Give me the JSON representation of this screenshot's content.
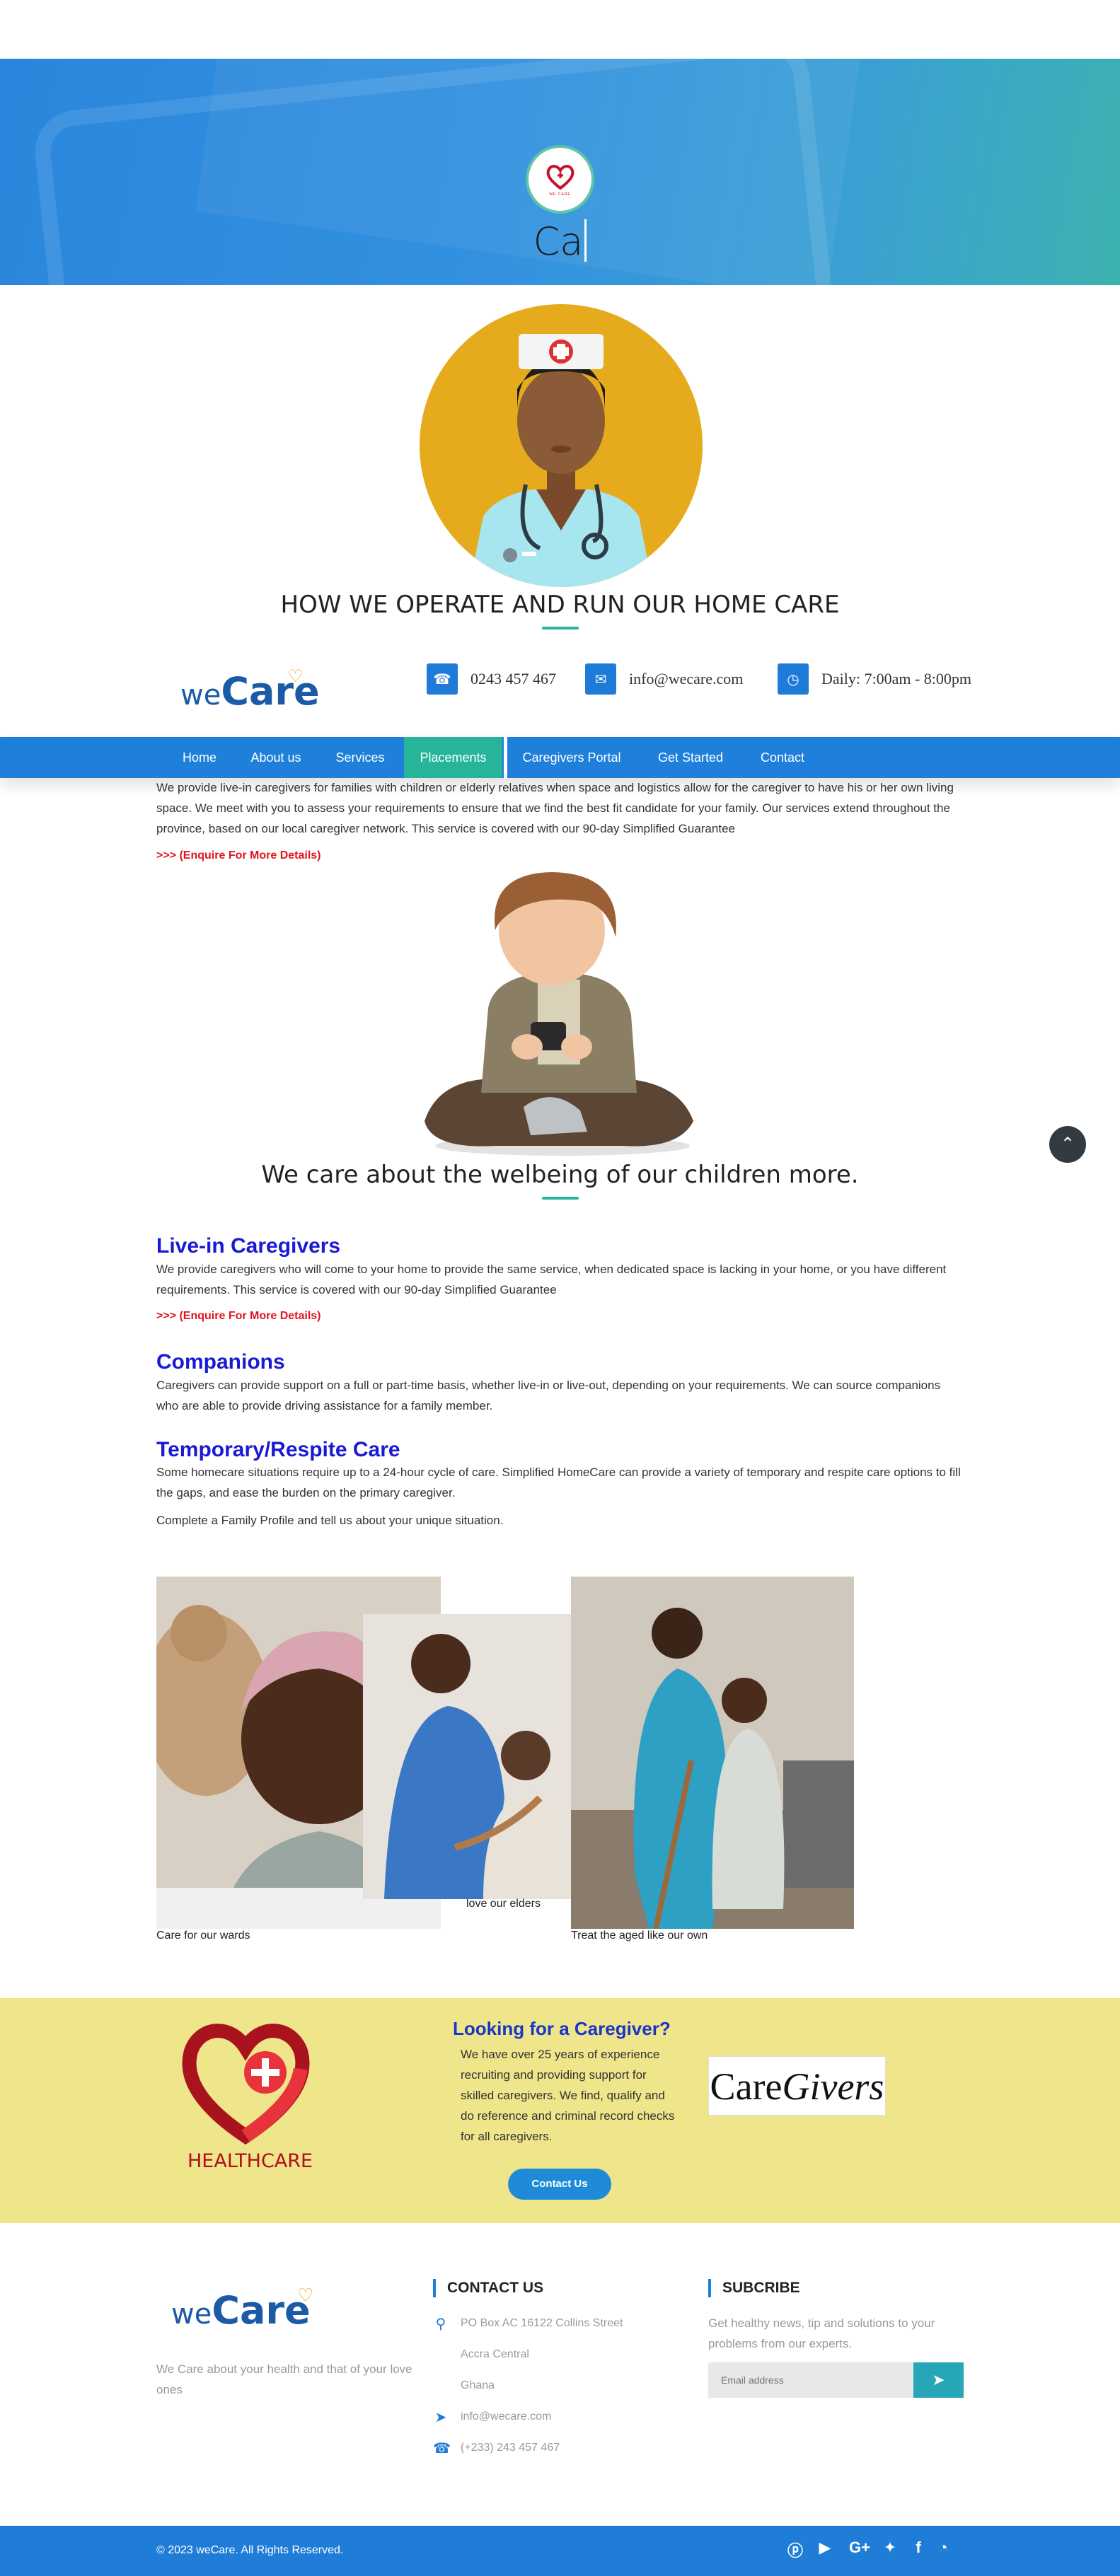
{
  "hero": {
    "typing_text": "Ca",
    "logo_caption": "WE CARE"
  },
  "operate": {
    "heading": "HOW WE OPERATE AND RUN OUR HOME CARE"
  },
  "header": {
    "brand_we": "we",
    "brand_care": "Care",
    "phone": "0243 457 467",
    "email": "info@wecare.com",
    "hours": "Daily: 7:00am - 8:00pm"
  },
  "nav": {
    "items": [
      "Home",
      "About us",
      "Services",
      "Placements",
      "Caregivers Portal",
      "Get Started",
      "Contact"
    ],
    "active": "Placements"
  },
  "placements": {
    "intro_text": "We provide live-in caregivers for families with children or elderly relatives when space and logistics allow for the caregiver to have his or her own living space. We meet with you to assess your requirements to ensure that we find the best fit candidate for your family. Our services extend throughout the province, based on our local caregiver network. This service is covered with our 90-day Simplified Guarantee",
    "enquire_1": ">>> (Enquire For More Details)",
    "children_heading": "We care about the welbeing of our children more.",
    "live_in_title": "Live-in Caregivers",
    "live_in_text": "We provide caregivers who will come to your home to provide the same service, when dedicated space is lacking in your home, or you have different requirements. This service is covered with our 90-day Simplified Guarantee",
    "enquire_2": ">>> (Enquire For More Details)",
    "companions_title": "Companions",
    "companions_text": "Caregivers can provide support on a full or part-time basis, whether live-in or live-out, depending on your requirements. We can source companions who are able to provide driving assistance for a family member.",
    "respite_title": "Temporary/Respite Care",
    "respite_text": "Some homecare situations require up to a 24-hour cycle of care. Simplified HomeCare can provide a variety of temporary and respite care options to fill the gaps, and ease the burden on the primary caregiver.",
    "profile_text": "Complete a Family Profile and tell us about your unique situation."
  },
  "gallery": {
    "caption_1": "Care for our wards",
    "caption_2": "love our elders",
    "caption_3": "Treat the aged like our own"
  },
  "cta": {
    "healthcare_label": "HEALTHCARE",
    "title": "Looking for a Caregiver?",
    "text": "We have over 25 years of experience recruiting and providing support for skilled caregivers. We find, qualify and do reference and criminal record checks for all caregivers.",
    "button": "Contact Us",
    "partner_care": "Care",
    "partner_givers": "Givers"
  },
  "footer": {
    "about": "We Care about your health and that of your love ones",
    "contact_heading": "CONTACT US",
    "address_1": "PO Box AC 16122 Collins Street",
    "address_2": "Accra Central",
    "address_3": "Ghana",
    "email": "info@wecare.com",
    "phone": "(+233) 243 457 467",
    "subscribe_heading": "SUBCRIBE",
    "subscribe_text": "Get healthy news, tip and solutions to your problems from our experts.",
    "email_placeholder": "Email address",
    "copyright": "© 2023 weCare. All Rights Reserved."
  },
  "colors": {
    "primary": "#1f80dc",
    "accent": "#26b59b",
    "heading_blue": "#1a1ad6",
    "enquire_red": "#e0141e",
    "band_yellow": "#efe58a"
  },
  "icons": {
    "phone": "phone-icon",
    "mail": "mail-icon",
    "clock": "clock-icon",
    "map_pin": "map-pin-icon",
    "send": "send-icon",
    "scroll_top": "chevron-up-icon",
    "social": [
      "pinterest-icon",
      "youtube-icon",
      "google-plus-icon",
      "twitter-icon",
      "facebook-icon",
      "rss-icon"
    ]
  }
}
